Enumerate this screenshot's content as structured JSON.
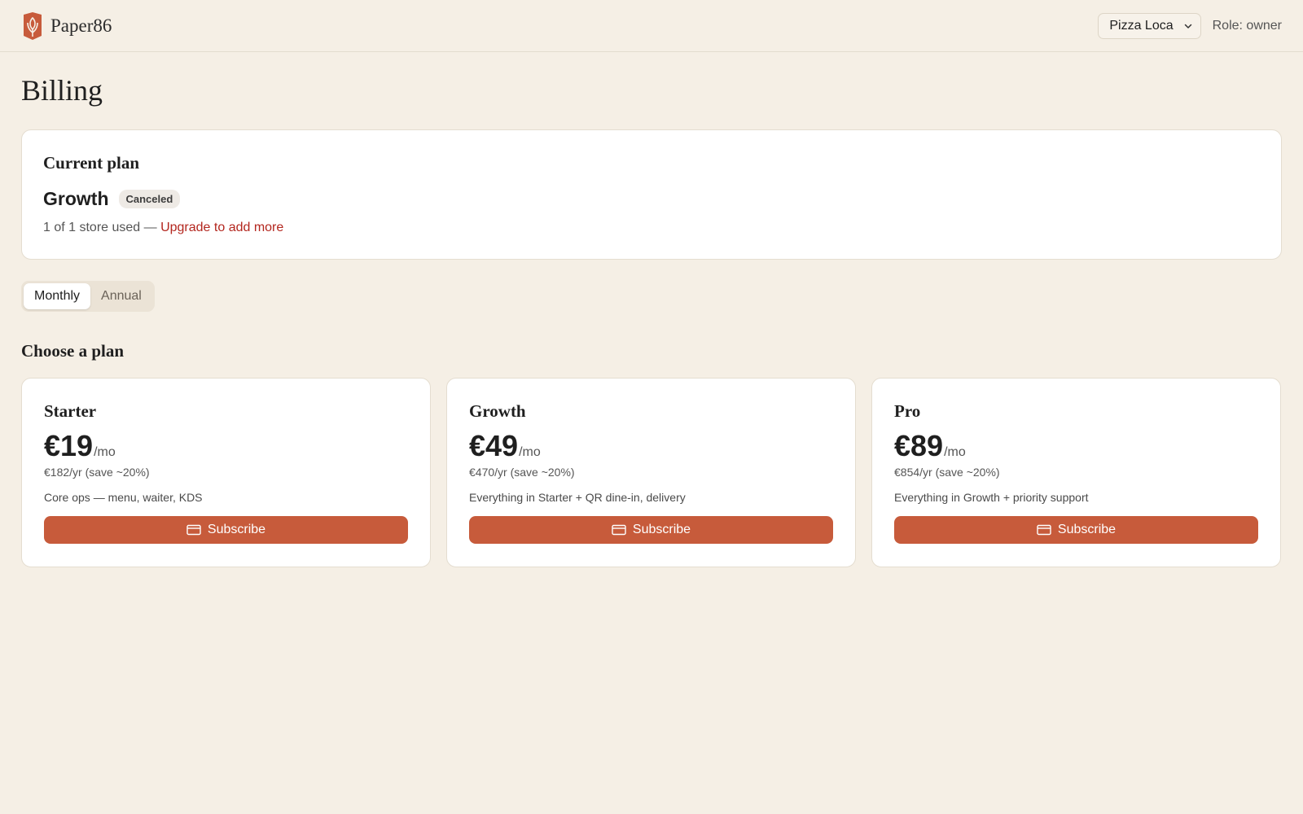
{
  "brand": {
    "name": "Paper86",
    "logo_icon": "wheat-shield-logo",
    "accent": "#c75b3b"
  },
  "header": {
    "store_select": {
      "value": "Pizza Loca",
      "icon": "chevron-down-icon"
    },
    "role": "Role: owner"
  },
  "page": {
    "title": "Billing"
  },
  "current_plan": {
    "heading": "Current plan",
    "plan_name": "Growth",
    "status": "Canceled",
    "usage_text": "1 of 1 store used — ",
    "upgrade_link": "Upgrade to add more"
  },
  "billing_toggle": {
    "options": [
      "Monthly",
      "Annual"
    ],
    "selected": "Monthly"
  },
  "plans_section": {
    "heading": "Choose a plan",
    "plans": [
      {
        "name": "Starter",
        "price": "€19",
        "period": "/mo",
        "annual": "€182/yr (save ~20%)",
        "description": "Core ops — menu, waiter, KDS",
        "button": "Subscribe"
      },
      {
        "name": "Growth",
        "price": "€49",
        "period": "/mo",
        "annual": "€470/yr (save ~20%)",
        "description": "Everything in Starter + QR dine-in, delivery",
        "button": "Subscribe"
      },
      {
        "name": "Pro",
        "price": "€89",
        "period": "/mo",
        "annual": "€854/yr (save ~20%)",
        "description": "Everything in Growth + priority support",
        "button": "Subscribe"
      }
    ],
    "button_icon": "credit-card-icon"
  }
}
